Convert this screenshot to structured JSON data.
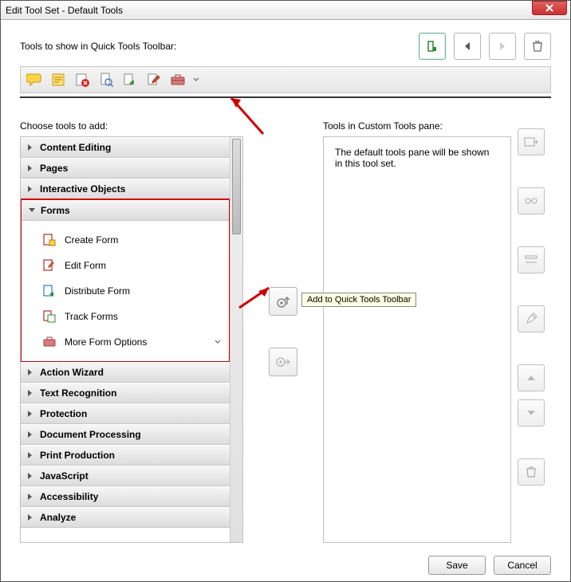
{
  "window": {
    "title": "Edit Tool Set - Default Tools"
  },
  "toolbar": {
    "label": "Tools to show in Quick Tools Toolbar:",
    "quick_icons": [
      "comment-bubble",
      "sticky-note",
      "stamp-x",
      "page-search",
      "page-export",
      "page-edit",
      "toolbox"
    ]
  },
  "left": {
    "label": "Choose tools to add:",
    "categories": [
      "Content Editing",
      "Pages",
      "Interactive Objects",
      "Forms",
      "Action Wizard",
      "Text Recognition",
      "Protection",
      "Document Processing",
      "Print Production",
      "JavaScript",
      "Accessibility",
      "Analyze"
    ],
    "forms_items": [
      "Create Form",
      "Edit Form",
      "Distribute Form",
      "Track Forms",
      "More Form Options"
    ]
  },
  "mid": {
    "tooltip": "Add to Quick Tools Toolbar"
  },
  "right": {
    "label": "Tools in Custom Tools pane:",
    "placeholder": "The default tools pane will be shown in this tool set."
  },
  "footer": {
    "save": "Save",
    "cancel": "Cancel"
  }
}
